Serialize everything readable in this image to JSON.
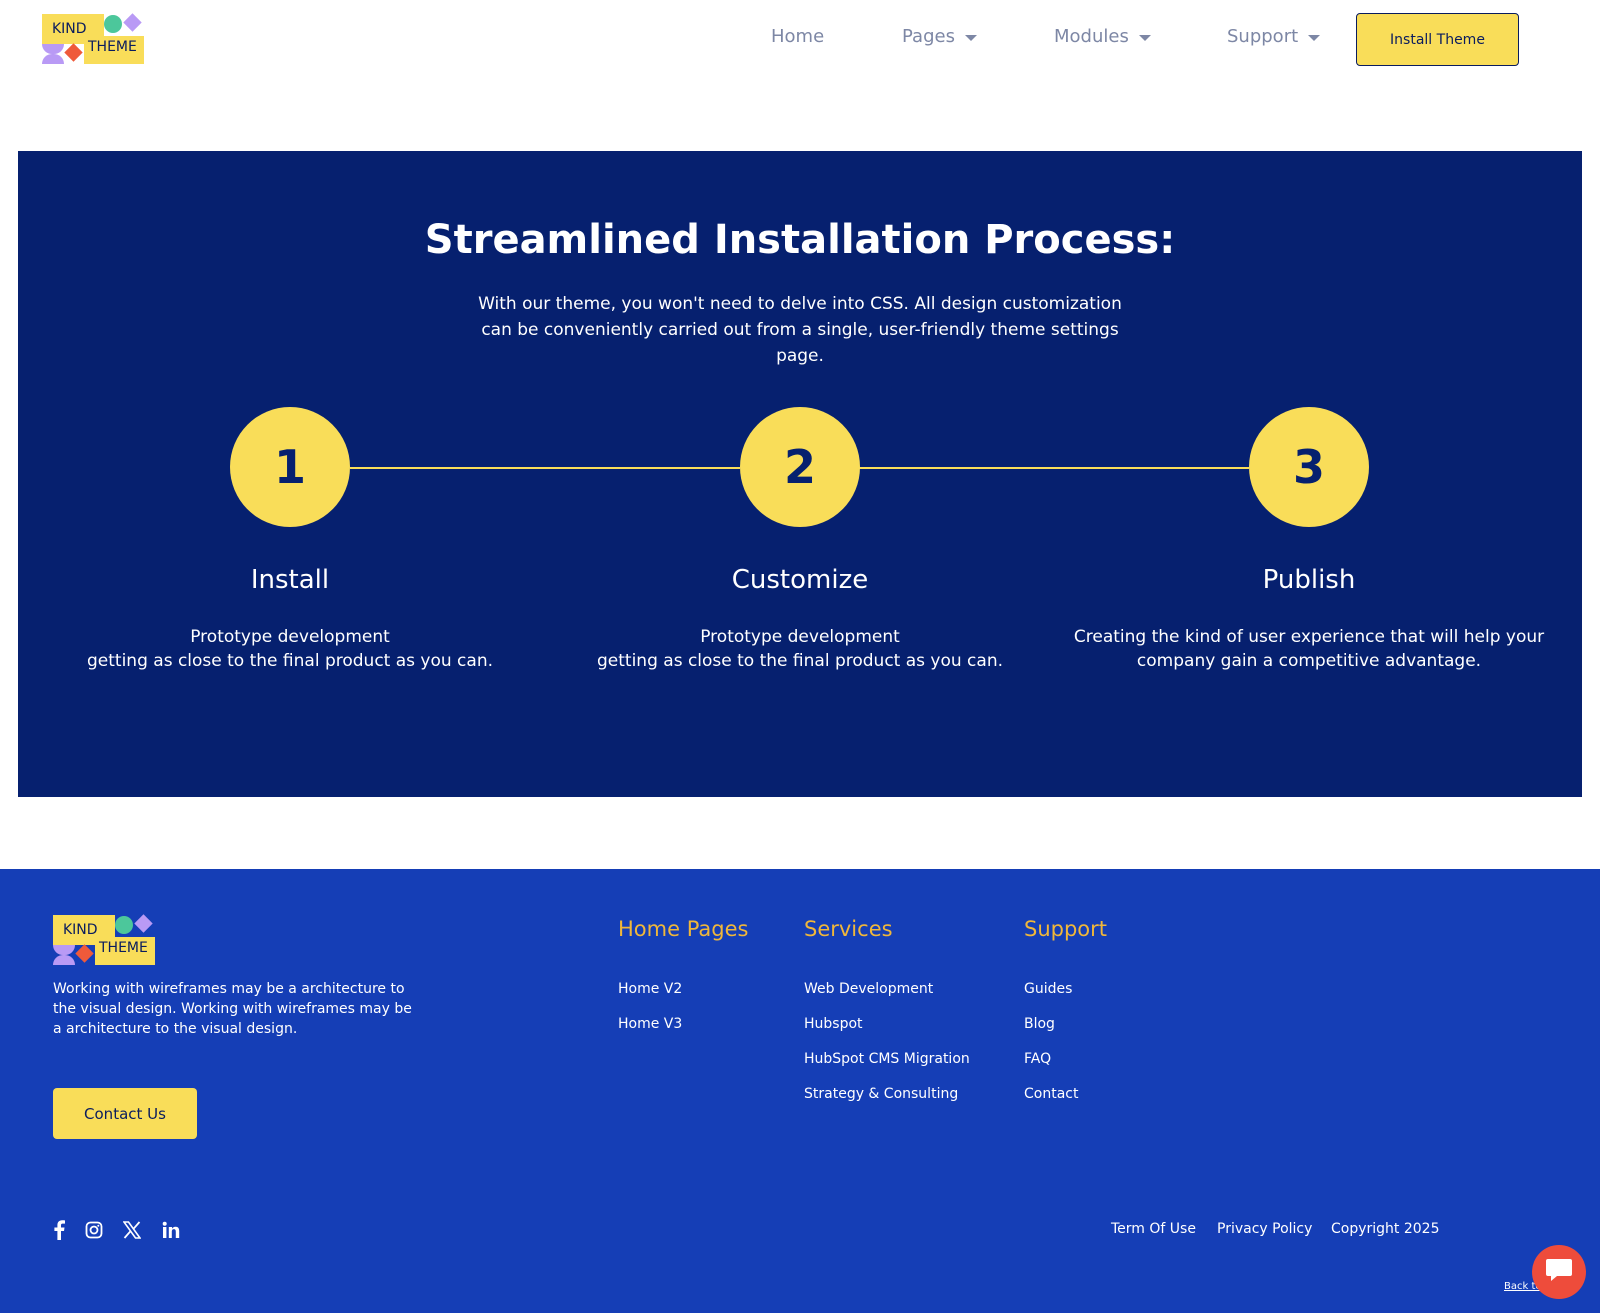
{
  "header": {
    "logo": {
      "word1": "KIND",
      "word2": "THEME"
    },
    "nav": [
      {
        "label": "Home"
      },
      {
        "label": "Pages"
      },
      {
        "label": "Modules"
      },
      {
        "label": "Support"
      }
    ],
    "cta_label": "Install Theme"
  },
  "process": {
    "title": "Streamlined Installation Process:",
    "description": "With our theme, you won't need to delve into CSS. All design customization can be conveniently carried out from a single, user-friendly theme settings page.",
    "steps": [
      {
        "number": "1",
        "title": "Install",
        "line1": "Prototype development",
        "line2": "getting as close to the final product as you can."
      },
      {
        "number": "2",
        "title": "Customize",
        "line1": "Prototype development",
        "line2": "getting as close to the final product as you can."
      },
      {
        "number": "3",
        "title": "Publish",
        "line1": "Creating the kind of user experience that will help your",
        "line2": "company gain a competitive advantage."
      }
    ]
  },
  "footer": {
    "logo": {
      "word1": "KIND",
      "word2": "THEME"
    },
    "about": "Working with wireframes may be a architecture to the visual design. Working with wireframes may be a architecture to the visual design.",
    "contact_label": "Contact Us",
    "columns": [
      {
        "title": "Home Pages",
        "links": [
          "Home V2",
          "Home V3"
        ]
      },
      {
        "title": "Services",
        "links": [
          "Web Development",
          "Hubspot",
          "HubSpot CMS Migration",
          "Strategy & Consulting"
        ]
      },
      {
        "title": "Support",
        "links": [
          "Guides",
          "Blog",
          "FAQ",
          "Contact"
        ]
      }
    ],
    "social_icons": [
      "facebook-icon",
      "instagram-icon",
      "x-icon",
      "linkedin-icon"
    ],
    "legal": {
      "terms": "Term Of Use",
      "privacy": "Privacy Policy",
      "copyright": "Copyright 2025"
    },
    "back_to_top": "Back to"
  },
  "colors": {
    "brand_yellow": "#f9dd59",
    "navy": "#06206f",
    "footer_blue": "#153eb6",
    "footer_heading": "#f0b73a",
    "chat_red": "#ee4c3b"
  }
}
